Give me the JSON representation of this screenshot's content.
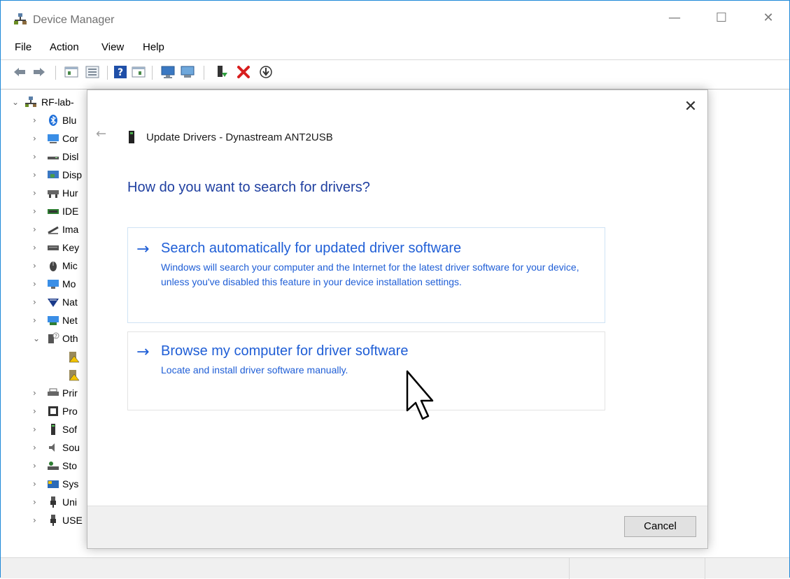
{
  "window": {
    "title": "Device Manager",
    "controls": {
      "minimize": "—",
      "maximize": "☐",
      "close": "✕"
    }
  },
  "menubar": {
    "items": [
      "File",
      "Action",
      "View",
      "Help"
    ]
  },
  "toolbar": {
    "buttons": [
      "back-arrow-icon",
      "forward-arrow-icon",
      "properties-view-icon",
      "device-list-icon",
      "help-icon",
      "properties-icon",
      "scan-monitor-icon",
      "computer-icon",
      "enable-device-icon",
      "uninstall-x-icon",
      "update-driver-icon"
    ]
  },
  "tree": {
    "root": "RF-lab-",
    "items": [
      {
        "label": "Blu",
        "icon": "bluetooth-icon",
        "expanded": false
      },
      {
        "label": "Cor",
        "icon": "computer-icon",
        "expanded": false
      },
      {
        "label": "Disl",
        "icon": "disk-drive-icon",
        "expanded": false
      },
      {
        "label": "Disp",
        "icon": "display-adapter-icon",
        "expanded": false
      },
      {
        "label": "Hur",
        "icon": "hid-icon",
        "expanded": false
      },
      {
        "label": "IDE",
        "icon": "ide-controller-icon",
        "expanded": false
      },
      {
        "label": "Ima",
        "icon": "imaging-device-icon",
        "expanded": false
      },
      {
        "label": "Key",
        "icon": "keyboard-icon",
        "expanded": false
      },
      {
        "label": "Mic",
        "icon": "mouse-icon",
        "expanded": false
      },
      {
        "label": "Mo",
        "icon": "monitor-icon",
        "expanded": false
      },
      {
        "label": "Nat",
        "icon": "national-instruments-icon",
        "expanded": false
      },
      {
        "label": "Net",
        "icon": "network-adapter-icon",
        "expanded": false
      },
      {
        "label": "Oth",
        "icon": "other-devices-icon",
        "expanded": true
      },
      {
        "label": "",
        "icon": "warning-device-icon",
        "expanded": null
      },
      {
        "label": "",
        "icon": "warning-device-icon",
        "expanded": null
      },
      {
        "label": "Prir",
        "icon": "print-queue-icon",
        "expanded": false
      },
      {
        "label": "Pro",
        "icon": "processor-icon",
        "expanded": false
      },
      {
        "label": "Sof",
        "icon": "software-device-icon",
        "expanded": false
      },
      {
        "label": "Sou",
        "icon": "sound-icon",
        "expanded": false
      },
      {
        "label": "Sto",
        "icon": "storage-controller-icon",
        "expanded": false
      },
      {
        "label": "Sys",
        "icon": "system-devices-icon",
        "expanded": false
      },
      {
        "label": "Uni",
        "icon": "usb-controller-icon",
        "expanded": false
      },
      {
        "label": "USE",
        "icon": "usb-device-icon",
        "expanded": false
      }
    ]
  },
  "dialog": {
    "title": "Update Drivers - Dynastream ANT2USB",
    "heading": "How do you want to search for drivers?",
    "options": [
      {
        "title": "Search automatically for updated driver software",
        "description": "Windows will search your computer and the Internet for the latest driver software for your device, unless you've disabled this feature in your device installation settings."
      },
      {
        "title": "Browse my computer for driver software",
        "description": "Locate and install driver software manually."
      }
    ],
    "cancel_label": "Cancel",
    "close_glyph": "✕",
    "back_glyph": "←",
    "arrow_glyph": "→"
  },
  "colors": {
    "link_blue": "#1f5ed6",
    "heading_blue": "#1f3fa0",
    "window_border": "#1e88d8"
  }
}
